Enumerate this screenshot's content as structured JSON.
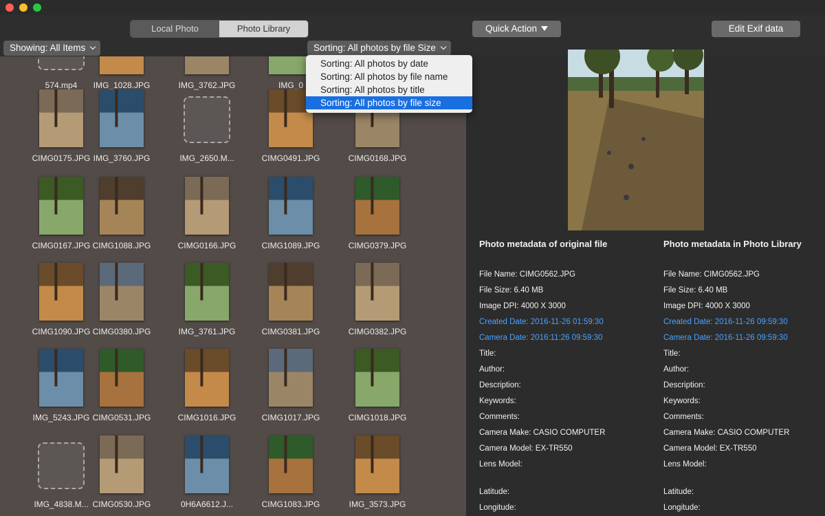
{
  "window": {
    "controls": [
      "close",
      "minimize",
      "zoom"
    ]
  },
  "toolbar": {
    "tabs": [
      {
        "label": "Local Photo",
        "active": false
      },
      {
        "label": "Photo Library",
        "active": true
      }
    ],
    "quick_action_label": "Quick Action",
    "edit_exif_label": "Edit Exif data",
    "showing_label": "Showing: All Items",
    "sorting_label": "Sorting: All photos by file Size"
  },
  "sort_menu": {
    "items": [
      {
        "label": "Sorting: All photos by date",
        "selected": false
      },
      {
        "label": "Sorting: All photos by file name",
        "selected": false
      },
      {
        "label": "Sorting: All photos by title",
        "selected": false
      },
      {
        "label": "Sorting: All photos by file size",
        "selected": true
      }
    ]
  },
  "grid": {
    "items": [
      {
        "name": "574.mp4",
        "kind": "placeholder"
      },
      {
        "name": "IMG_1028.JPG",
        "kind": "photo"
      },
      {
        "name": "IMG_3762.JPG",
        "kind": "photo"
      },
      {
        "name": "IMG_0",
        "kind": "photo"
      },
      {
        "name": "",
        "kind": "photo"
      },
      {
        "name": "CIMG0175.JPG",
        "kind": "photo"
      },
      {
        "name": "IMG_3760.JPG",
        "kind": "photo"
      },
      {
        "name": "IMG_2650.M...",
        "kind": "placeholder"
      },
      {
        "name": "CIMG0491.JPG",
        "kind": "photo"
      },
      {
        "name": "CIMG0168.JPG",
        "kind": "photo"
      },
      {
        "name": "CIMG0167.JPG",
        "kind": "photo"
      },
      {
        "name": "CIMG1088.JPG",
        "kind": "photo"
      },
      {
        "name": "CIMG0166.JPG",
        "kind": "photo"
      },
      {
        "name": "CIMG1089.JPG",
        "kind": "photo"
      },
      {
        "name": "CIMG0379.JPG",
        "kind": "photo"
      },
      {
        "name": "CIMG1090.JPG",
        "kind": "photo"
      },
      {
        "name": "CIMG0380.JPG",
        "kind": "photo"
      },
      {
        "name": "IMG_3761.JPG",
        "kind": "photo"
      },
      {
        "name": "CIMG0381.JPG",
        "kind": "photo"
      },
      {
        "name": "CIMG0382.JPG",
        "kind": "photo"
      },
      {
        "name": "IMG_5243.JPG",
        "kind": "photo"
      },
      {
        "name": "CIMG0531.JPG",
        "kind": "photo"
      },
      {
        "name": "CIMG1016.JPG",
        "kind": "photo"
      },
      {
        "name": "CIMG1017.JPG",
        "kind": "photo"
      },
      {
        "name": "CIMG1018.JPG",
        "kind": "photo"
      },
      {
        "name": "IMG_4838.M...",
        "kind": "placeholder"
      },
      {
        "name": "CIMG0530.JPG",
        "kind": "photo"
      },
      {
        "name": "0H6A6612.J...",
        "kind": "photo"
      },
      {
        "name": "CIMG1083.JPG",
        "kind": "photo"
      },
      {
        "name": "IMG_3573.JPG",
        "kind": "photo"
      }
    ]
  },
  "metadata": {
    "original": {
      "title": "Photo metadata of original file",
      "file_name": "File Name: CIMG0562.JPG",
      "file_size": "File Size: 6.40 MB",
      "image_dpi": "Image DPI: 4000 X 3000",
      "created_date": "Created Date: 2016-11-26 01:59:30",
      "camera_date": "Camera Date: 2016:11:26 09:59:30",
      "title_field": "Title:",
      "author": "Author:",
      "description": "Description:",
      "keywords": "Keywords:",
      "comments": "Comments:",
      "camera_make": "Camera Make: CASIO COMPUTER",
      "camera_model": "Camera Model: EX-TR550",
      "lens_model": "Lens Model:",
      "latitude": "Latitude:",
      "longitude": "Longitude:"
    },
    "library": {
      "title": "Photo metadata in Photo Library",
      "file_name": "File Name: CIMG0562.JPG",
      "file_size": "File Size: 6.40 MB",
      "image_dpi": "Image DPI: 4000 X 3000",
      "created_date": "Created Date: 2016-11-26 09:59:30",
      "camera_date": "Camera Date: 2016-11-26 09:59:30",
      "title_field": "Title:",
      "author": "Author:",
      "description": "Description:",
      "keywords": "Keywords:",
      "comments": "Comments:",
      "camera_make": "Camera Make: CASIO COMPUTER",
      "camera_model": "Camera Model: EX-TR550",
      "lens_model": "Lens Model:",
      "latitude": "Latitude:",
      "longitude": "Longitude:"
    }
  }
}
